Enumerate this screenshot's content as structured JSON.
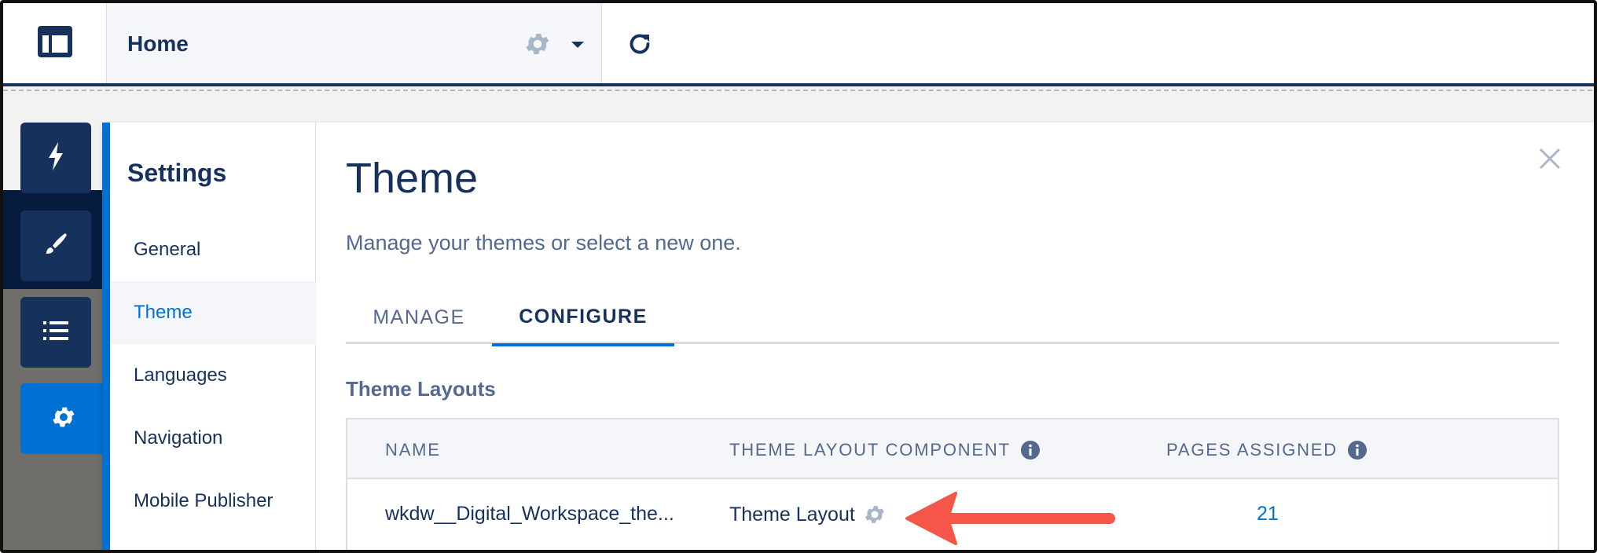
{
  "header": {
    "page_title": "Home",
    "icons": [
      "layout-icon",
      "gear-icon",
      "chevron-down-icon",
      "refresh-icon"
    ]
  },
  "rail": {
    "items": [
      {
        "icon": "lightning-icon"
      },
      {
        "icon": "brush-icon"
      },
      {
        "icon": "list-icon"
      },
      {
        "icon": "gear-icon",
        "active": true
      }
    ]
  },
  "settings": {
    "heading": "Settings",
    "nav": [
      {
        "label": "General"
      },
      {
        "label": "Theme",
        "selected": true
      },
      {
        "label": "Languages"
      },
      {
        "label": "Navigation"
      },
      {
        "label": "Mobile Publisher"
      }
    ]
  },
  "theme": {
    "title": "Theme",
    "subtitle": "Manage your themes or select a new one.",
    "tabs": [
      {
        "label": "MANAGE"
      },
      {
        "label": "CONFIGURE",
        "active": true
      }
    ],
    "section_label": "Theme Layouts",
    "table": {
      "columns": [
        "NAME",
        "THEME LAYOUT COMPONENT",
        "PAGES ASSIGNED"
      ],
      "rows": [
        {
          "name": "wkdw__Digital_Workspace_the...",
          "component": "Theme Layout",
          "pages_assigned": "21"
        }
      ]
    }
  },
  "colors": {
    "brand_blue": "#0070d2",
    "navy": "#16325c",
    "muted": "#54698d",
    "arrow_red": "#f4574a"
  }
}
